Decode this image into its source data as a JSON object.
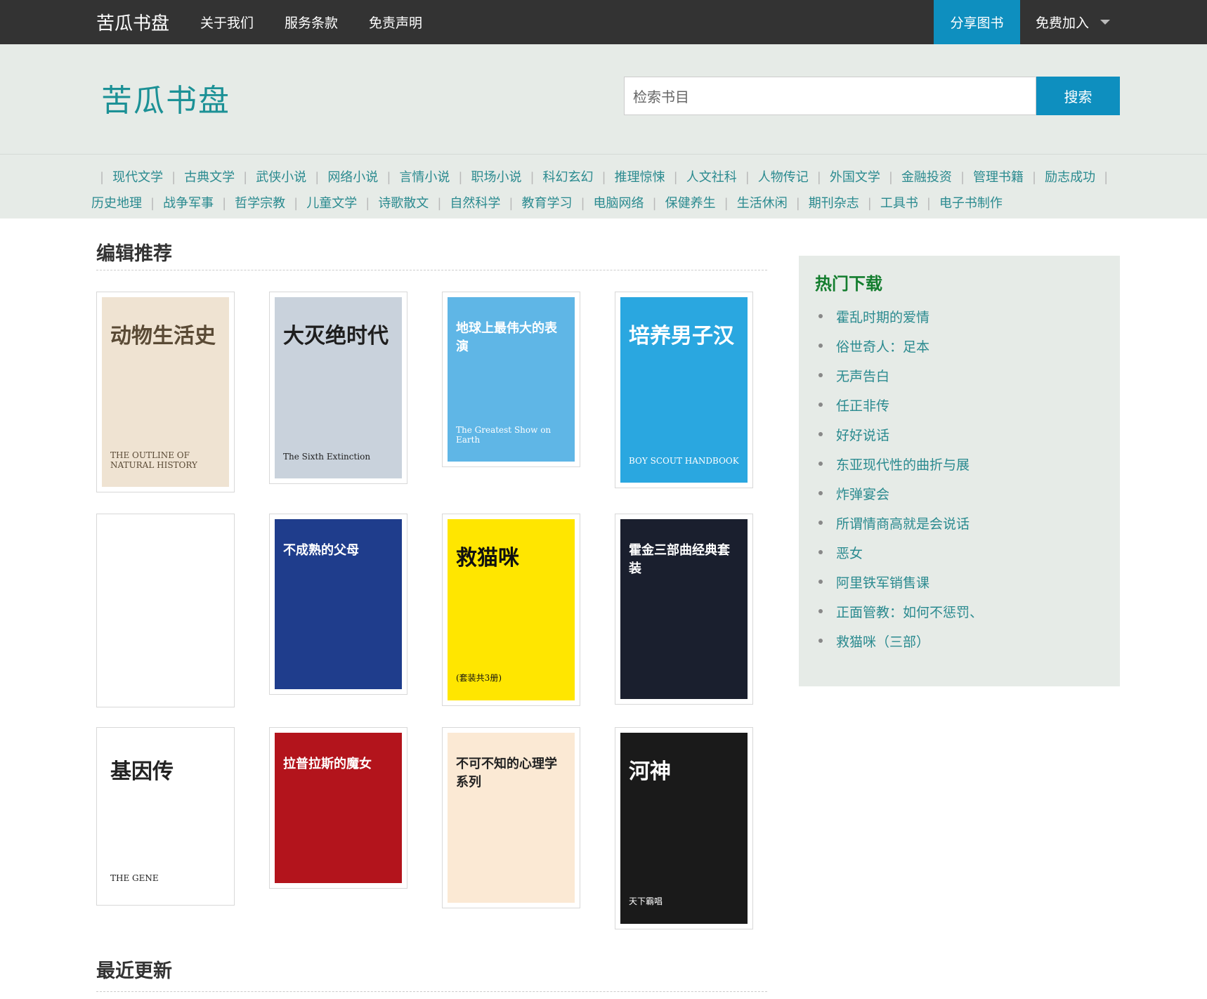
{
  "topbar": {
    "brand": "苦瓜书盘",
    "links": [
      "关于我们",
      "服务条款",
      "免责声明"
    ],
    "share_label": "分享图书",
    "join_label": "免费加入"
  },
  "header": {
    "logo": "苦瓜书盘",
    "search_placeholder": "检索书目",
    "search_button": "搜索"
  },
  "categories": [
    "现代文学",
    "古典文学",
    "武侠小说",
    "网络小说",
    "言情小说",
    "职场小说",
    "科幻玄幻",
    "推理惊悚",
    "人文社科",
    "人物传记",
    "外国文学",
    "金融投资",
    "管理书籍",
    "励志成功",
    "历史地理",
    "战争军事",
    "哲学宗教",
    "儿童文学",
    "诗歌散文",
    "自然科学",
    "教育学习",
    "电脑网络",
    "保健养生",
    "生活休闲",
    "期刊杂志",
    "工具书",
    "电子书制作"
  ],
  "editor": {
    "title": "编辑推荐",
    "books": [
      {
        "cover_text": "动物生活史",
        "sub": "THE OUTLINE OF NATURAL HISTORY",
        "bg": "#efe3d2",
        "fg": "#5a4a35"
      },
      {
        "cover_text": "大灭绝时代",
        "sub": "The Sixth Extinction",
        "bg": "#c9d2dc",
        "fg": "#1e1e1e"
      },
      {
        "cover_text": "地球上最伟大的表演",
        "sub": "The Greatest Show on Earth",
        "bg": "#5fb6e6",
        "fg": "#ffffff"
      },
      {
        "cover_text": "培养男子汉",
        "sub": "BOY SCOUT HANDBOOK",
        "bg": "#2aa7e0",
        "fg": "#ffffff"
      },
      {
        "cover_text": "",
        "sub": "",
        "bg": "#ffffff",
        "fg": "#ffffff"
      },
      {
        "cover_text": "不成熟的父母",
        "sub": "",
        "bg": "#1f3d8c",
        "fg": "#ffffff"
      },
      {
        "cover_text": "救猫咪",
        "sub": "(套装共3册)",
        "bg": "#ffe600",
        "fg": "#111111"
      },
      {
        "cover_text": "霍金三部曲经典套装",
        "sub": "",
        "bg": "#1a1f2e",
        "fg": "#ffffff"
      },
      {
        "cover_text": "基因传",
        "sub": "THE GENE",
        "bg": "#ffffff",
        "fg": "#222222"
      },
      {
        "cover_text": "拉普拉斯的魔女",
        "sub": "",
        "bg": "#b3141c",
        "fg": "#ffffff"
      },
      {
        "cover_text": "不可不知的心理学系列",
        "sub": "",
        "bg": "#fbe9d4",
        "fg": "#222222"
      },
      {
        "cover_text": "河神",
        "sub": "天下霸唱",
        "bg": "#1a1a1a",
        "fg": "#ffffff"
      }
    ]
  },
  "hot": {
    "title": "热门下载",
    "items": [
      "霍乱时期的爱情",
      "俗世奇人：足本",
      "无声告白",
      "任正非传",
      "好好说话",
      "东亚现代性的曲折与展",
      "炸弹宴会",
      "所谓情商高就是会说话",
      "恶女",
      "阿里铁军销售课",
      "正面管教：如何不惩罚、",
      "救猫咪（三部）"
    ]
  },
  "recent": {
    "title": "最近更新"
  }
}
